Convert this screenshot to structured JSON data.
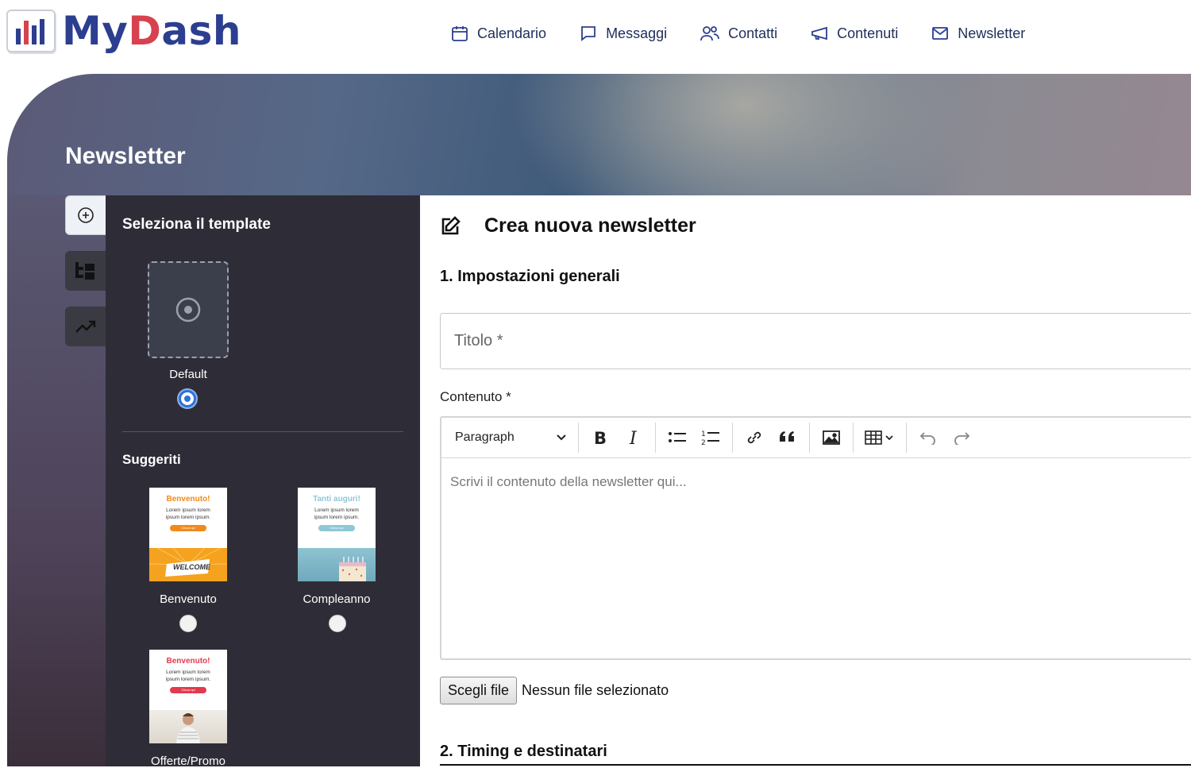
{
  "header": {
    "logo_my": "My",
    "logo_d": "D",
    "logo_rest": "ash",
    "nav": [
      {
        "label": "Calendario",
        "icon": "calendar-icon"
      },
      {
        "label": "Messaggi",
        "icon": "chat-bubble-icon"
      },
      {
        "label": "Contatti",
        "icon": "users-icon"
      },
      {
        "label": "Contenuti",
        "icon": "megaphone-icon"
      },
      {
        "label": "Newsletter",
        "icon": "envelope-icon"
      }
    ]
  },
  "page": {
    "title": "Newsletter"
  },
  "templates": {
    "heading": "Seleziona il template",
    "default_label": "Default",
    "suggested_heading": "Suggeriti",
    "selected": "Default",
    "items": [
      {
        "label": "Benvenuto",
        "thumb_title": "Benvenuto!",
        "thumb_body": "Lorem ipsum lorem ipsum lorem ipsum.",
        "thumb_button": "Clicca qui",
        "thumb_banner": "WELCOME",
        "accent": "#f08a1c"
      },
      {
        "label": "Compleanno",
        "thumb_title": "Tanti auguri!",
        "thumb_body": "Lorem ipsum lorem ipsum lorem ipsum.",
        "thumb_button": "Clicca qui",
        "accent": "#8fc6d8"
      },
      {
        "label": "Offerte/Promo",
        "thumb_title": "Benvenuto!",
        "thumb_body": "Lorem ipsum lorem ipsum lorem ipsum.",
        "thumb_button": "Clicca qui",
        "accent": "#e23b4e"
      }
    ]
  },
  "form": {
    "title": "Crea nuova newsletter",
    "section1": "1. Impostazioni generali",
    "title_placeholder": "Titolo *",
    "content_label": "Contenuto *",
    "format_select": "Paragraph",
    "editor_placeholder": "Scrivi il contenuto della newsletter qui...",
    "file_button": "Scegli file",
    "file_status": "Nessun file selezionato",
    "section2": "2. Timing e destinatari"
  },
  "colors": {
    "brand_blue": "#2c3e8f",
    "brand_red": "#d8414e",
    "radio_selected": "#2f6fd8"
  }
}
